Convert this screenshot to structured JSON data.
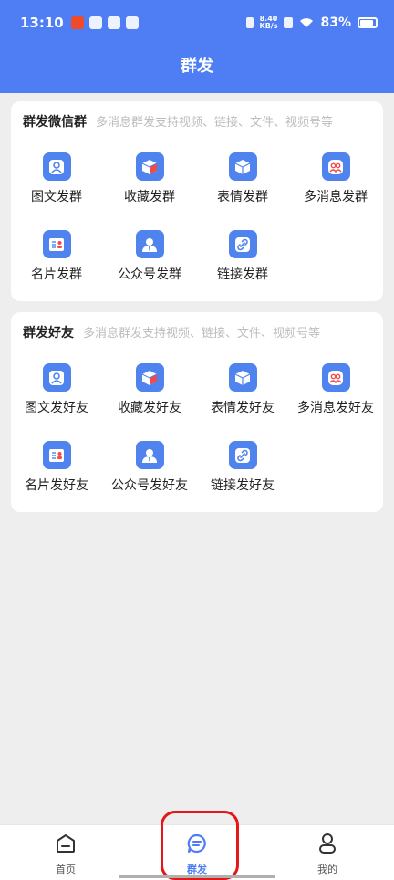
{
  "status_bar": {
    "time": "13:10",
    "net_speed_value": "8.40",
    "net_speed_unit": "KB/s",
    "battery": "83%"
  },
  "header": {
    "title": "群发"
  },
  "groups_section": {
    "title": "群发微信群",
    "subtitle": "多消息群发支持视频、链接、文件、视频号等",
    "items": [
      {
        "label": "图文发群",
        "icon": "image-text-icon"
      },
      {
        "label": "收藏发群",
        "icon": "favorites-box-icon"
      },
      {
        "label": "表情发群",
        "icon": "sticker-box-icon"
      },
      {
        "label": "多消息发群",
        "icon": "multi-message-icon"
      },
      {
        "label": "名片发群",
        "icon": "business-card-icon"
      },
      {
        "label": "公众号发群",
        "icon": "official-account-icon"
      },
      {
        "label": "链接发群",
        "icon": "link-icon"
      }
    ]
  },
  "friends_section": {
    "title": "群发好友",
    "subtitle": "多消息群发支持视频、链接、文件、视频号等",
    "items": [
      {
        "label": "图文发好友",
        "icon": "image-text-icon"
      },
      {
        "label": "收藏发好友",
        "icon": "favorites-box-icon"
      },
      {
        "label": "表情发好友",
        "icon": "sticker-box-icon"
      },
      {
        "label": "多消息发好友",
        "icon": "multi-message-icon"
      },
      {
        "label": "名片发好友",
        "icon": "business-card-icon"
      },
      {
        "label": "公众号发好友",
        "icon": "official-account-icon"
      },
      {
        "label": "链接发好友",
        "icon": "link-icon"
      }
    ]
  },
  "bottom_nav": {
    "items": [
      {
        "label": "首页",
        "icon": "home-icon",
        "active": false
      },
      {
        "label": "群发",
        "icon": "message-bubble-icon",
        "active": true
      },
      {
        "label": "我的",
        "icon": "person-icon",
        "active": false
      }
    ]
  },
  "colors": {
    "primary": "#4f7df3",
    "tile": "#4f84ef",
    "accent_red": "#f04a4a",
    "highlight_outline": "#e31818",
    "background": "#eeeeee"
  }
}
